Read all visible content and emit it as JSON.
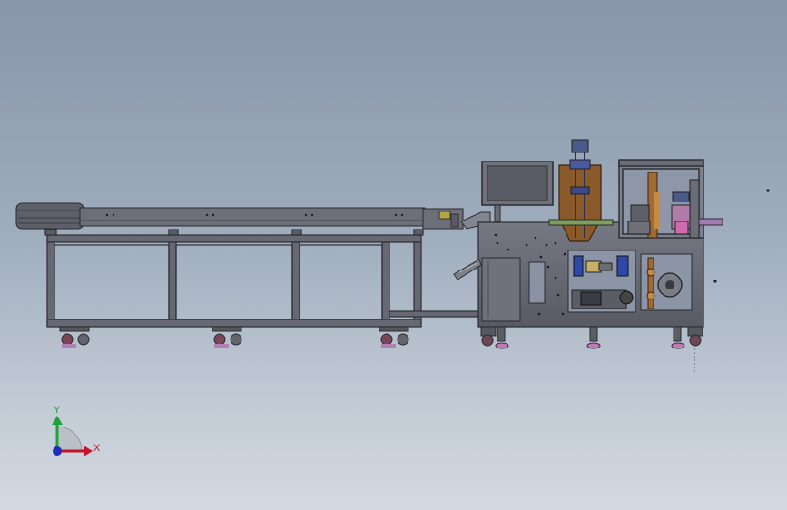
{
  "view": {
    "background_top": "#8796a9",
    "background_bottom": "#d3d9e0",
    "frame_color": "#5b5d66",
    "panel_color": "#6a6c76"
  },
  "triad": {
    "x_label": "X",
    "y_label": "Y",
    "x_color": "#c8142b",
    "y_color": "#1ea33a",
    "z_color": "#1d2fb8"
  }
}
